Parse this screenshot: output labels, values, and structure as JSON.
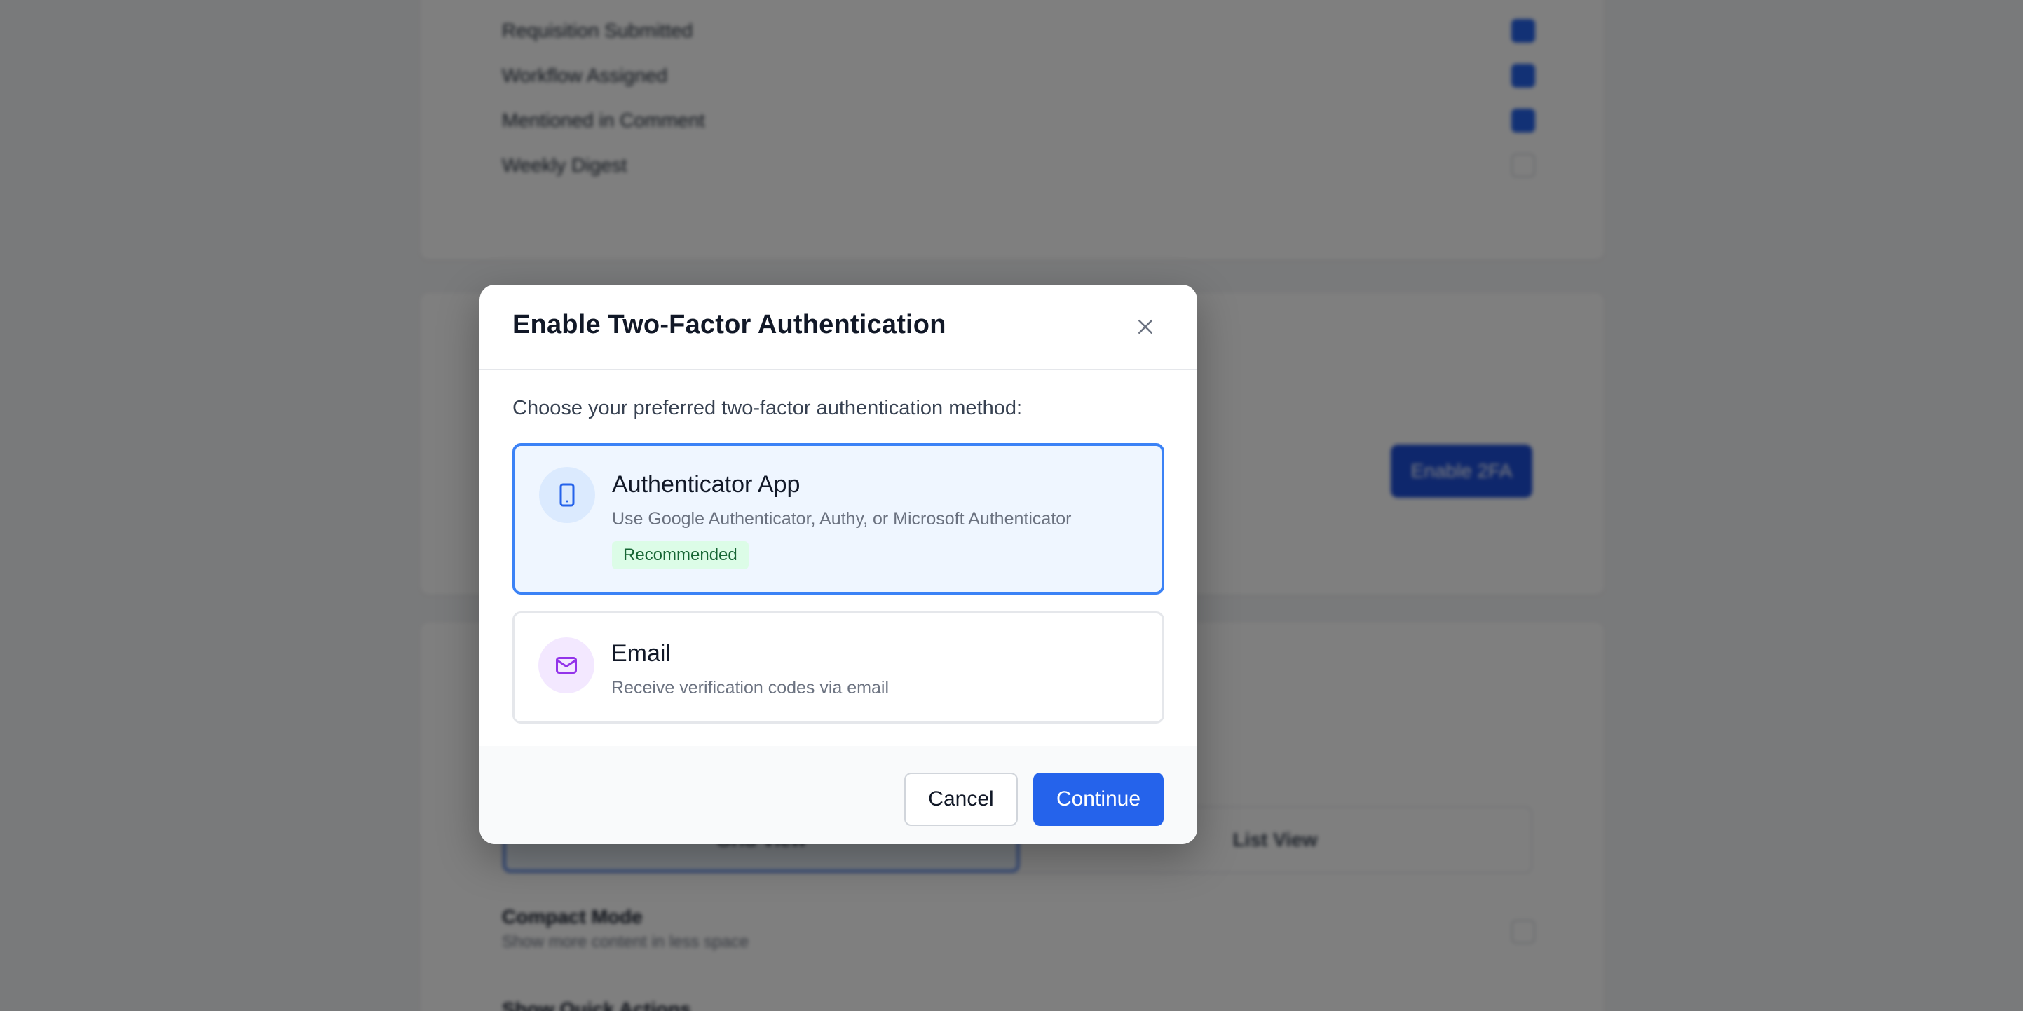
{
  "background": {
    "notifications": [
      {
        "label": "Requisition Submitted",
        "checked": true
      },
      {
        "label": "Workflow Assigned",
        "checked": true
      },
      {
        "label": "Mentioned in Comment",
        "checked": true
      },
      {
        "label": "Weekly Digest",
        "checked": false
      }
    ],
    "enable_2fa_button": "Enable 2FA",
    "view_options": [
      "Grid View",
      "List View"
    ],
    "settings": [
      {
        "title": "Compact Mode",
        "desc": "Show more content in less space"
      },
      {
        "title": "Show Quick Actions",
        "desc": ""
      }
    ]
  },
  "modal": {
    "title": "Enable Two-Factor Authentication",
    "prompt": "Choose your preferred two-factor authentication method:",
    "options": [
      {
        "title": "Authenticator App",
        "description": "Use Google Authenticator, Authy, or Microsoft Authenticator",
        "badge": "Recommended",
        "icon": "smartphone-icon",
        "selected": true
      },
      {
        "title": "Email",
        "description": "Receive verification codes via email",
        "icon": "mail-icon",
        "selected": false
      }
    ],
    "cancel_label": "Cancel",
    "continue_label": "Continue"
  },
  "colors": {
    "primary": "#2563eb",
    "selected_bg": "#eff6ff",
    "badge_bg": "#dcfce7",
    "badge_text": "#166534",
    "email_icon_bg": "#f3e8ff",
    "email_icon": "#9333ea"
  }
}
